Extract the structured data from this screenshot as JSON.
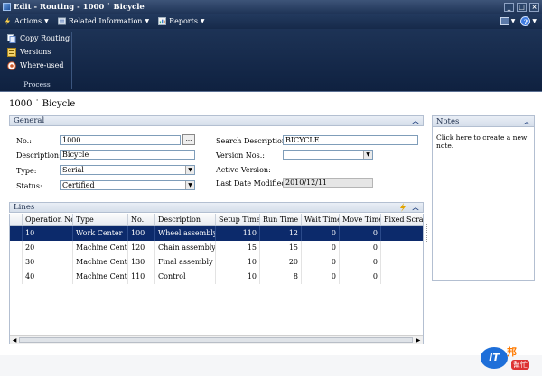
{
  "window": {
    "title": "Edit - Routing - 1000   ˙ Bicycle"
  },
  "menubar": {
    "actions": "Actions",
    "related": "Related Information",
    "reports": "Reports",
    "help": "?"
  },
  "ribbon": {
    "items": [
      {
        "label": "Copy Routing",
        "icon": "copy-icon"
      },
      {
        "label": "Versions",
        "icon": "versions-icon"
      },
      {
        "label": "Where-used",
        "icon": "where-used-icon"
      }
    ],
    "group_label": "Process"
  },
  "page_title": "1000 ˙ Bicycle",
  "general": {
    "header": "General",
    "no_label": "No.:",
    "no_value": "1000",
    "assist": "...",
    "description_label": "Description:",
    "description_value": "Bicycle",
    "type_label": "Type:",
    "type_value": "Serial",
    "status_label": "Status:",
    "status_value": "Certified",
    "search_label": "Search Description:",
    "search_value": "BICYCLE",
    "version_label": "Version Nos.:",
    "version_value": "",
    "active_version_label": "Active Version:",
    "last_modified_label": "Last Date Modified:",
    "last_modified_value": "2010/12/11"
  },
  "lines": {
    "header": "Lines",
    "columns": [
      "Operation No.",
      "Type",
      "No.",
      "Description",
      "Setup Time",
      "Run Time",
      "Wait Time",
      "Move Time",
      "Fixed Scrap Q"
    ],
    "rows": [
      [
        "10",
        "Work Center",
        "100",
        "Wheel assembly",
        "110",
        "12",
        "0",
        "0",
        ""
      ],
      [
        "20",
        "Machine Center",
        "120",
        "Chain assembly",
        "15",
        "15",
        "0",
        "0",
        ""
      ],
      [
        "30",
        "Machine Center",
        "130",
        "Final assembly",
        "10",
        "20",
        "0",
        "0",
        ""
      ],
      [
        "40",
        "Machine Center",
        "110",
        "Control",
        "10",
        "8",
        "0",
        "0",
        ""
      ]
    ]
  },
  "notes": {
    "header": "Notes",
    "text": "Click here to create a new note."
  },
  "watermark": {
    "logo_text": "IT",
    "word": "邦",
    "sub": "幫忙"
  },
  "colors": {
    "chrome": "#1d3356",
    "selection": "#0c2a6b",
    "accent": "#1a3a7a"
  }
}
